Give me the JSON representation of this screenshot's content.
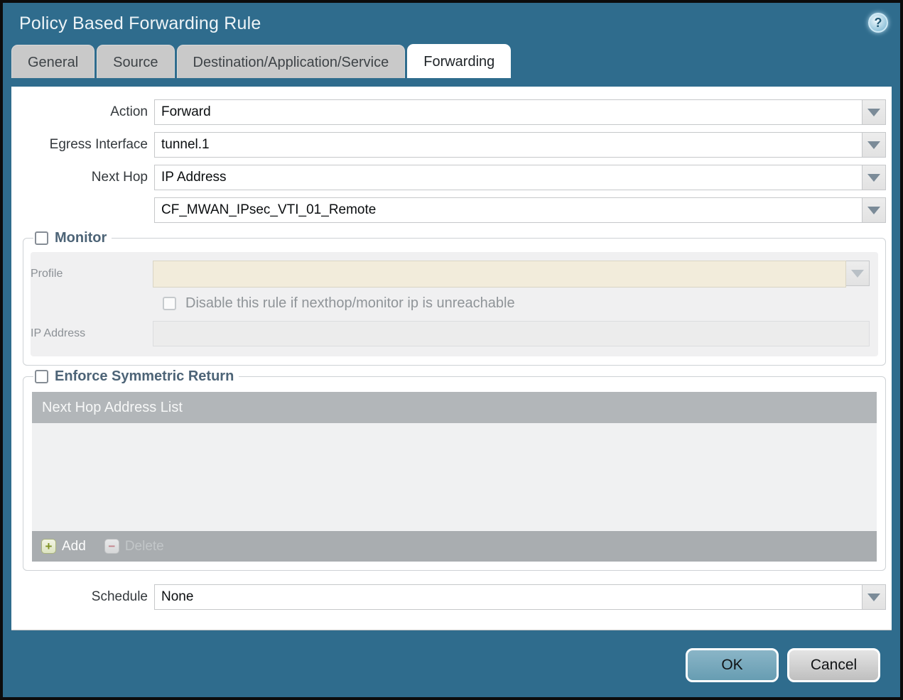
{
  "dialog": {
    "title": "Policy Based Forwarding Rule",
    "help_icon": "?"
  },
  "tabs": [
    {
      "label": "General",
      "active": false
    },
    {
      "label": "Source",
      "active": false
    },
    {
      "label": "Destination/Application/Service",
      "active": false
    },
    {
      "label": "Forwarding",
      "active": true
    }
  ],
  "form": {
    "action": {
      "label": "Action",
      "value": "Forward"
    },
    "egress_interface": {
      "label": "Egress Interface",
      "value": "tunnel.1"
    },
    "next_hop": {
      "label": "Next Hop",
      "value": "IP Address"
    },
    "next_hop_address": {
      "value": "CF_MWAN_IPsec_VTI_01_Remote"
    },
    "schedule": {
      "label": "Schedule",
      "value": "None"
    }
  },
  "monitor": {
    "legend": "Monitor",
    "checked": false,
    "profile": {
      "label": "Profile",
      "value": ""
    },
    "disable_rule_checkbox": {
      "label": "Disable this rule if nexthop/monitor ip is unreachable",
      "checked": false
    },
    "ip_address": {
      "label": "IP Address",
      "value": ""
    }
  },
  "symmetric_return": {
    "legend": "Enforce Symmetric Return",
    "checked": false,
    "table": {
      "header": "Next Hop Address List",
      "rows": []
    },
    "add_button": "Add",
    "delete_button": "Delete"
  },
  "footer": {
    "ok": "OK",
    "cancel": "Cancel"
  },
  "colors": {
    "titlebar_teal": "#2f6c8d",
    "tab_inactive": "#c9c9c9",
    "legend_slate": "#4d6477",
    "profile_disabled_bg": "#f2ecdb",
    "table_header_gray": "#b2b6b9",
    "ok_button": "#679db2",
    "add_plus_green": "#7f9224",
    "delete_minus_red": "#c4848d"
  }
}
